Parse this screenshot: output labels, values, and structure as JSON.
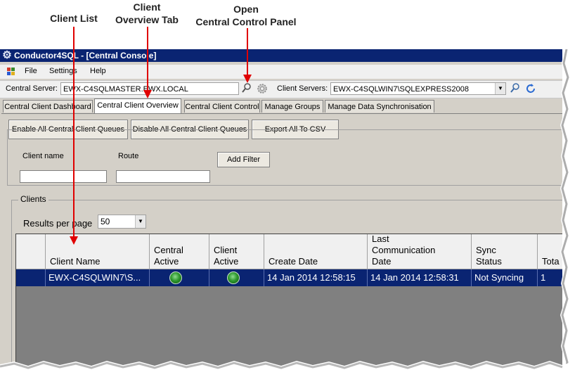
{
  "annotations": {
    "client_list": "Client List",
    "client_overview_tab_line1": "Client",
    "client_overview_tab_line2": "Overview Tab",
    "open_panel_line1": "Open",
    "open_panel_line2": "Central Control Panel",
    "arrow_color": "#e00000"
  },
  "window": {
    "title": "Conductor4SQL - [Central Console]",
    "title_icon": "gear-icon",
    "titlebar_color": "#0a2472"
  },
  "menu": {
    "items": [
      "File",
      "Settings",
      "Help"
    ]
  },
  "toolbar": {
    "central_server_label": "Central Server:",
    "central_server_value": "EWX-C4SQLMASTER.EWX.LOCAL",
    "client_servers_label": "Client Servers:",
    "client_servers_value": "EWX-C4SQLWIN7\\SQLEXPRESS2008"
  },
  "tabs": [
    {
      "label": "Central Client Dashboard",
      "active": false
    },
    {
      "label": "Central Client Overview",
      "active": true
    },
    {
      "label": "Central Client Control",
      "active": false
    },
    {
      "label": "Manage Groups",
      "active": false
    },
    {
      "label": "Manage Data Synchronisation",
      "active": false
    }
  ],
  "actions": {
    "enable": "Enable All Central Client Queues",
    "disable": "Disable All Central Client Queues",
    "export": "Export All To CSV"
  },
  "filters": {
    "client_name_label": "Client name",
    "route_label": "Route",
    "client_name_value": "",
    "route_value": "",
    "add_filter": "Add Filter"
  },
  "clients": {
    "group_title": "Clients",
    "results_per_page_label": "Results per page",
    "results_per_page_value": "50",
    "columns": {
      "client_name": "Client Name",
      "central_active_1": "Central",
      "central_active_2": "Active",
      "client_active_1": "Client",
      "client_active_2": "Active",
      "create_date": "Create Date",
      "last_comm_1": "Last",
      "last_comm_2": "Communication",
      "last_comm_3": "Date",
      "sync_status_1": "Sync",
      "sync_status_2": "Status",
      "total": "Tota"
    },
    "rows": [
      {
        "client_name": "EWX-C4SQLWIN7\\S...",
        "central_active": true,
        "client_active": true,
        "create_date": "14 Jan 2014 12:58:15",
        "last_communication_date": "14 Jan 2014 12:58:31",
        "sync_status": "Not Syncing",
        "total": "1"
      }
    ],
    "selected_row_color": "#0a2472",
    "active_indicator_color": "#2f9a2f"
  }
}
